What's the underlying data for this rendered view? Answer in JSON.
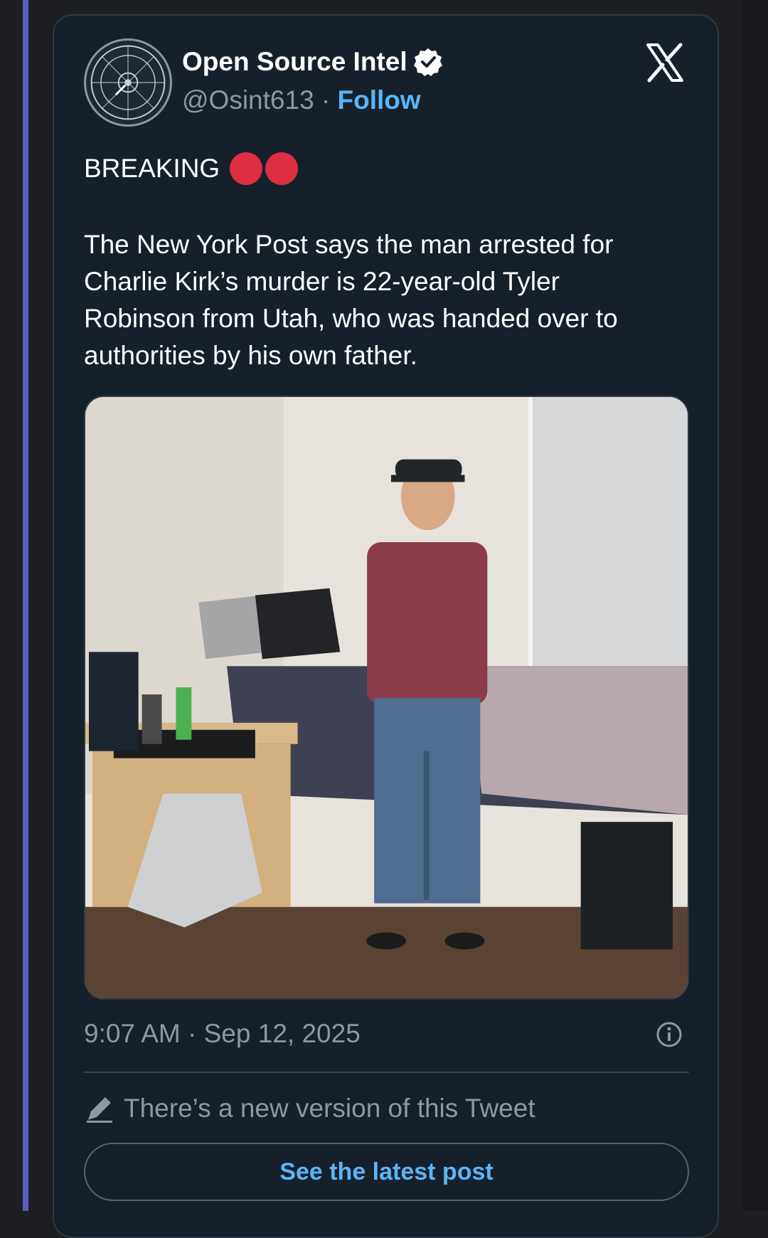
{
  "author": {
    "name": "Open Source Intel",
    "handle": "@Osint613",
    "separator": "·",
    "follow_label": "Follow",
    "avatar_icon": "open-source-intel-seal-icon",
    "verified_icon": "verified-badge-icon"
  },
  "platform_icon": "x-logo-icon",
  "tweet": {
    "headline": "BREAKING",
    "headline_emoji": "red-circle-emoji",
    "text": "The New York Post says the man arrested for Charlie Kirk’s murder is 22-year-old Tyler Robinson from Utah, who was handed over to authorities by his own father.",
    "image_icon": "photo-young-man-standing-in-dorm-room",
    "timestamp": "9:07 AM · Sep 12, 2025"
  },
  "edit_notice": {
    "text": "There’s a new version of this Tweet",
    "icon": "pencil-icon"
  },
  "cta": {
    "label": "See the latest post"
  },
  "colors": {
    "background": "#15202b",
    "accent": "#5bb4f5",
    "muted": "#8b98a5",
    "side_bar": "#5b5fbf"
  }
}
